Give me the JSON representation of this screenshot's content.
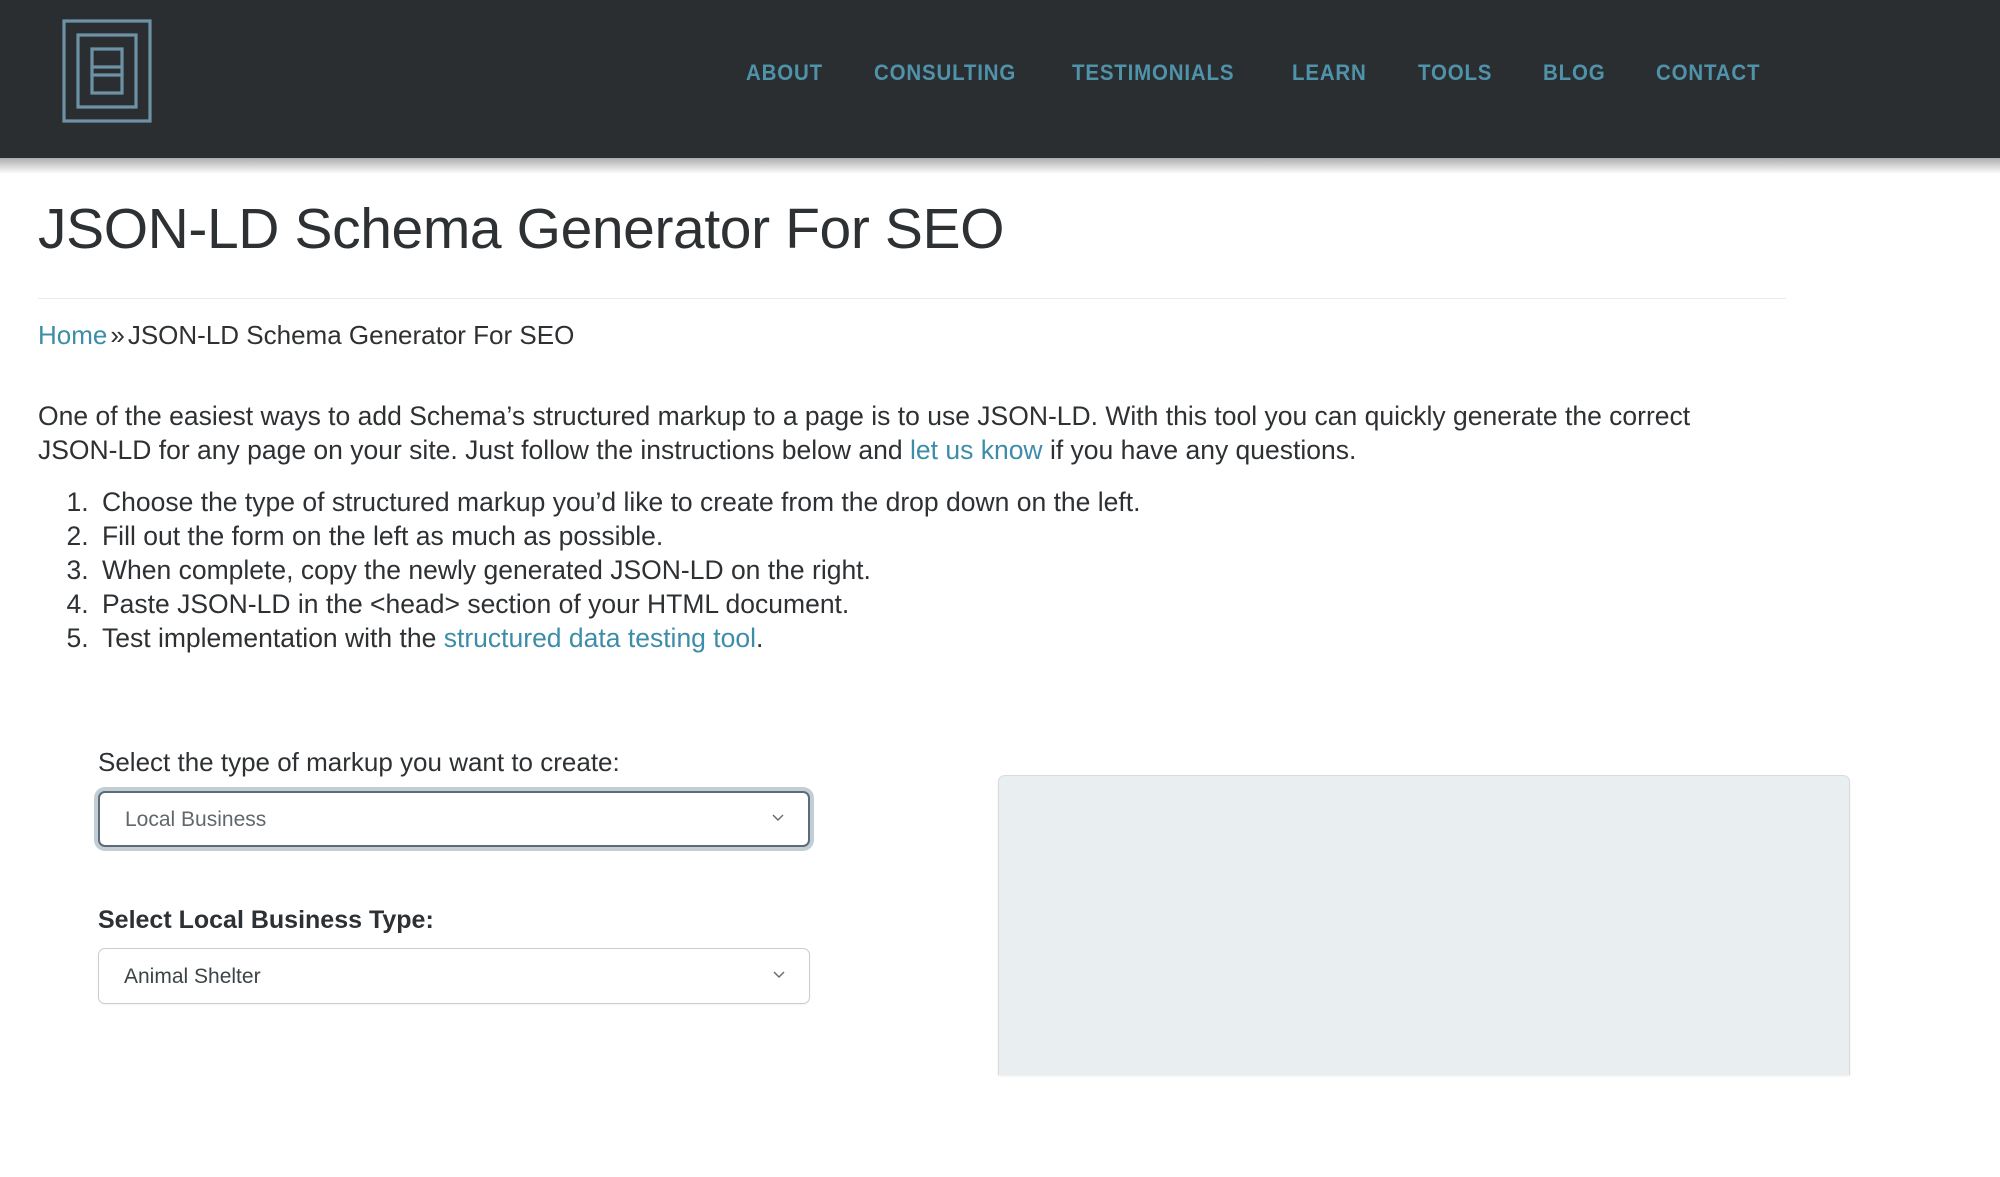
{
  "header": {
    "logo_name": "hoth-maze-h-logo",
    "logo_color": "#6d91a5",
    "background_color": "#2b2e31",
    "nav": [
      {
        "label": "ABOUT"
      },
      {
        "label": "CONSULTING"
      },
      {
        "label": "TESTIMONIALS"
      },
      {
        "label": "LEARN"
      },
      {
        "label": "TOOLS"
      },
      {
        "label": "BLOG"
      },
      {
        "label": "CONTACT"
      }
    ],
    "nav_color": "#4f93ab"
  },
  "page": {
    "title": "JSON-LD Schema Generator For SEO",
    "breadcrumb": {
      "home_label": "Home",
      "separator": "»",
      "current": "JSON-LD Schema Generator For SEO"
    },
    "intro": {
      "part1": "One of the easiest ways to add Schema’s structured markup to a page is to use JSON-LD. With this tool you can quickly generate the correct JSON-LD for any page on your site. Just follow the instructions below and ",
      "link_label": "let us know",
      "part2": " if you have any questions."
    },
    "steps": [
      {
        "text": "Choose the type of structured markup you’d like to create from the drop down on the left."
      },
      {
        "text": "Fill out the form on the left as much as possible."
      },
      {
        "text": "When complete, copy the newly generated JSON-LD on the right."
      },
      {
        "text": "Paste JSON-LD in the <head> section of your HTML document."
      }
    ],
    "step5": {
      "prefix": "Test implementation with the ",
      "link_label": "structured data testing tool",
      "suffix": "."
    },
    "link_color": "#3d8da8"
  },
  "form": {
    "markup_type": {
      "label": "Select the type of markup you want to create:",
      "value": "Local Business",
      "icon": "chevron-down-icon"
    },
    "business_type": {
      "label": "Select Local Business Type:",
      "value": "Animal Shelter",
      "icon": "chevron-down-icon"
    }
  },
  "output": {
    "content": "",
    "background_color": "#e9eef0"
  }
}
